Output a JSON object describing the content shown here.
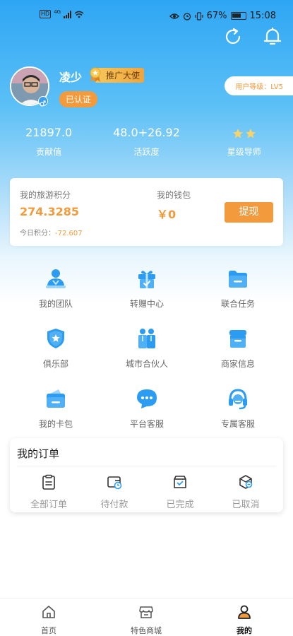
{
  "status_bar": {
    "network": "HD",
    "network_gen": "4G",
    "battery": "67%",
    "time": "15:08"
  },
  "header": {
    "refresh_icon": "refresh-icon",
    "bell_icon": "bell-icon"
  },
  "profile": {
    "username": "凌少",
    "ambassador_badge": "推广大使",
    "verified_label": "已认证",
    "level_label": "用户等级：LV5"
  },
  "stats": [
    {
      "value": "21897.0",
      "label": "贡献值"
    },
    {
      "value": "48.0+26.92",
      "label": "活跃度"
    },
    {
      "value": "",
      "label": "星级导师",
      "stars": 2
    }
  ],
  "wallet": {
    "points_title": "我的旅游积分",
    "points_value": "274.3285",
    "wallet_title": "我的钱包",
    "wallet_value": "￥0",
    "today_label": "今日积分：",
    "today_value": "-72.607",
    "withdraw_label": "提现"
  },
  "menu": [
    {
      "label": "我的团队",
      "icon": "team-icon"
    },
    {
      "label": "转赠中心",
      "icon": "gift-icon"
    },
    {
      "label": "联合任务",
      "icon": "folder-icon"
    },
    {
      "label": "俱乐部",
      "icon": "shield-star-icon"
    },
    {
      "label": "城市合伙人",
      "icon": "partners-icon"
    },
    {
      "label": "商家信息",
      "icon": "store-icon"
    },
    {
      "label": "我的卡包",
      "icon": "wallet-card-icon"
    },
    {
      "label": "平台客服",
      "icon": "chat-icon"
    },
    {
      "label": "专属客服",
      "icon": "headset-icon"
    }
  ],
  "orders": {
    "title": "我的订单",
    "items": [
      {
        "label": "全部订单",
        "icon": "clipboard-icon"
      },
      {
        "label": "待付款",
        "icon": "wallet-clock-icon"
      },
      {
        "label": "已完成",
        "icon": "box-check-icon"
      },
      {
        "label": "已取消",
        "icon": "box-cancel-icon"
      }
    ]
  },
  "tabbar": [
    {
      "label": "首页",
      "icon": "home-icon"
    },
    {
      "label": "特色商城",
      "icon": "shop-icon"
    },
    {
      "label": "我的",
      "icon": "profile-icon",
      "active": true
    }
  ],
  "colors": {
    "primary_blue": "#2ea6f4",
    "accent_orange": "#f39a3c",
    "icon_blue": "#2b9cf2"
  }
}
